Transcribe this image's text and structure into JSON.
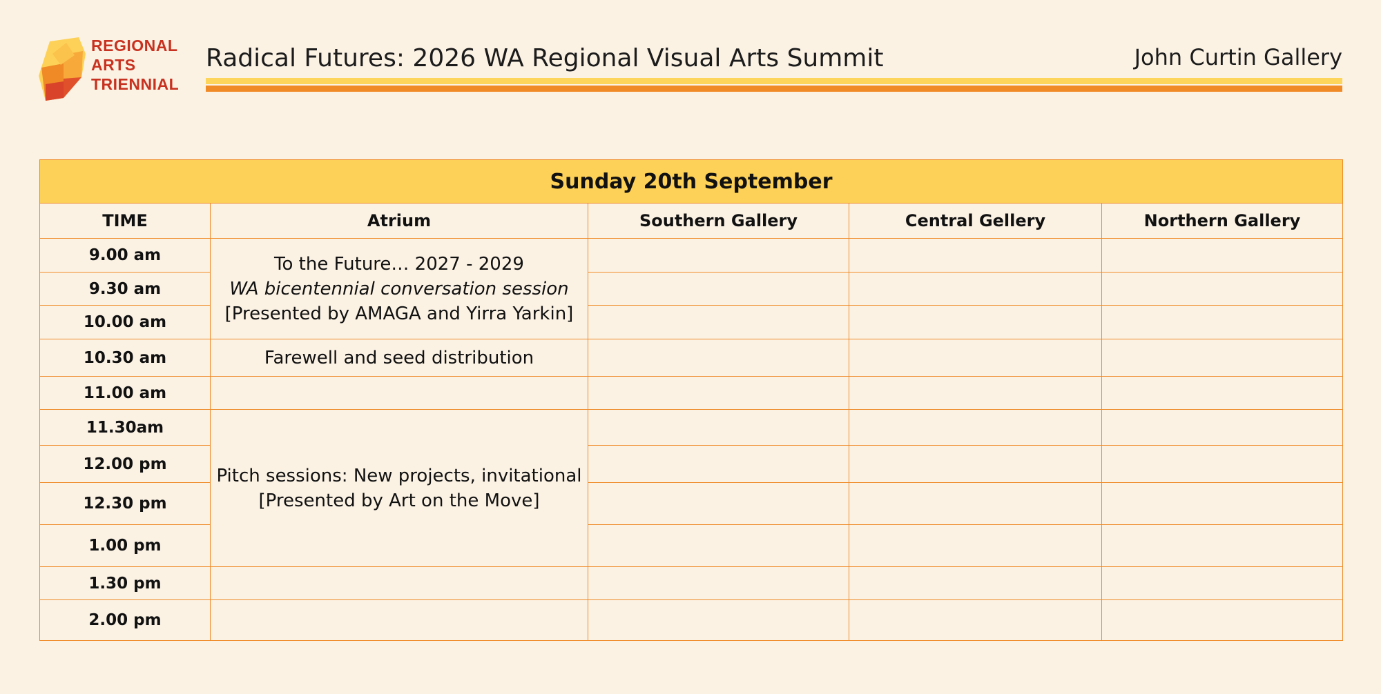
{
  "logo": {
    "line1": "REGIONAL",
    "line2": "ARTS",
    "line3": "TRIENNIAL"
  },
  "header": {
    "title": "Radical Futures: 2026 WA Regional Visual Arts Summit",
    "venue": "John Curtin Gallery"
  },
  "colors": {
    "background": "#fbf2e4",
    "accent_yellow": "#fdd157",
    "accent_orange": "#ef8a26",
    "logo_red": "#c8311f"
  },
  "schedule": {
    "day": "Sunday 20th September",
    "columns": [
      "TIME",
      "Atrium",
      "Southern Gallery",
      "Central Gellery",
      "Northern Gallery"
    ],
    "times": [
      "9.00 am",
      "9.30 am",
      "10.00 am",
      "10.30 am",
      "11.00 am",
      "11.30am",
      "12.00 pm",
      "12.30 pm",
      "1.00 pm",
      "1.30 pm",
      "2.00 pm"
    ],
    "events": {
      "future_session": {
        "line1": "To the Future… 2027 - 2029",
        "line2": "WA bicentennial conversation session",
        "line3": "[Presented by AMAGA and Yirra Yarkin]"
      },
      "farewell": "Farewell and seed distribution",
      "pitch_session": {
        "line1": "Pitch sessions: New projects,  invitational",
        "line2": "[Presented by Art on the Move]"
      }
    }
  }
}
